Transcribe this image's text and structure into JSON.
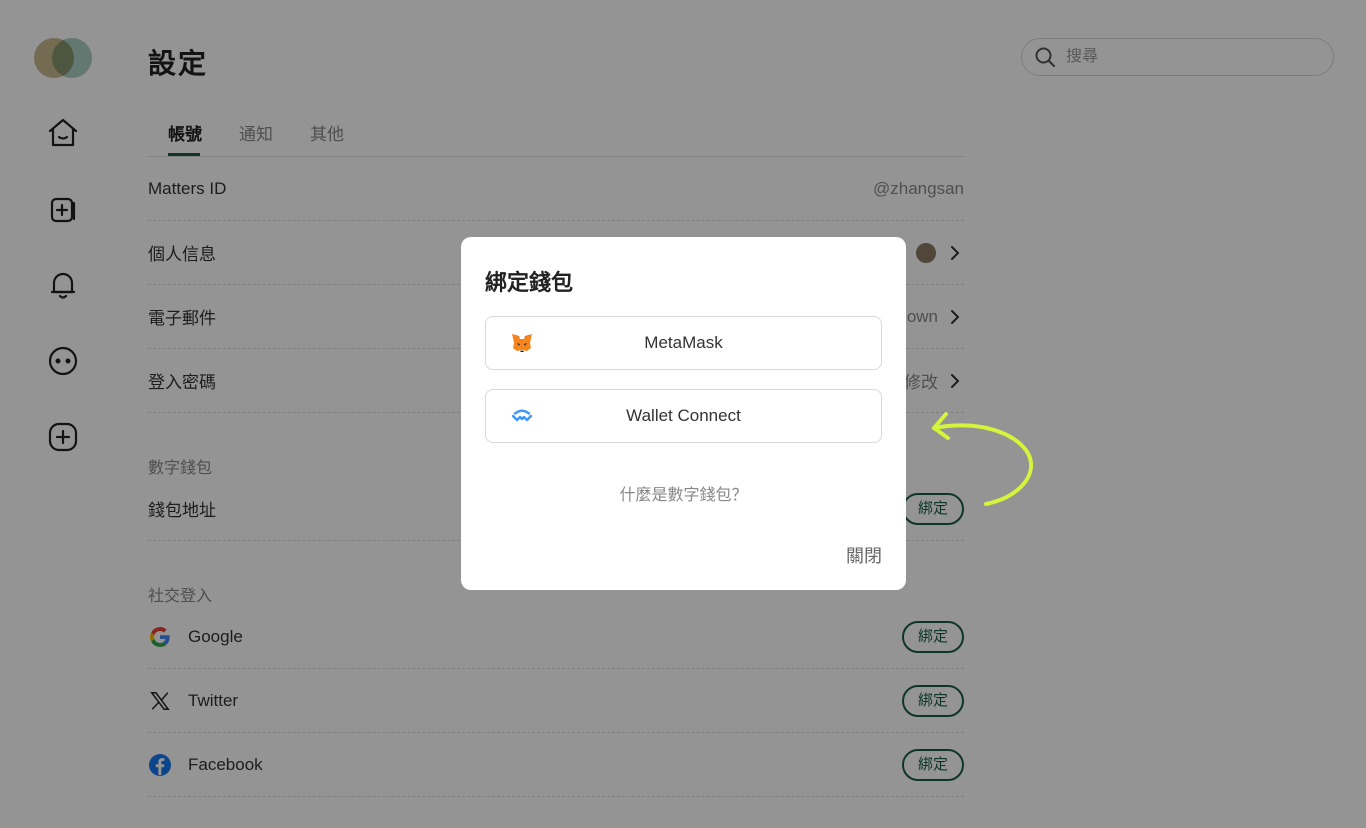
{
  "page": {
    "title": "設定"
  },
  "search": {
    "placeholder": "搜尋"
  },
  "tabs": [
    {
      "label": "帳號",
      "active": true
    },
    {
      "label": "通知",
      "active": false
    },
    {
      "label": "其他",
      "active": false
    }
  ],
  "account": {
    "matters_id": {
      "label": "Matters ID",
      "value": "@zhangsan"
    },
    "profile": {
      "label": "個人信息"
    },
    "email": {
      "label": "電子郵件",
      "value": "own"
    },
    "password": {
      "label": "登入密碼",
      "value": "修改"
    }
  },
  "wallet_section": {
    "title": "數字錢包",
    "address_label": "錢包地址",
    "bind_label": "綁定"
  },
  "social_section": {
    "title": "社交登入",
    "items": [
      {
        "label": "Google",
        "icon": "google-icon",
        "bind_label": "綁定"
      },
      {
        "label": "Twitter",
        "icon": "x-icon",
        "bind_label": "綁定"
      },
      {
        "label": "Facebook",
        "icon": "facebook-icon",
        "bind_label": "綁定"
      }
    ]
  },
  "dialog": {
    "title": "綁定錢包",
    "options": [
      {
        "label": "MetaMask",
        "icon": "metamask-fox-icon"
      },
      {
        "label": "Wallet Connect",
        "icon": "walletconnect-icon"
      }
    ],
    "help_link": "什麼是數字錢包？",
    "close_label": "關閉"
  },
  "colors": {
    "accent": "#1b5c4a",
    "annotation_arrow": "#d4f53c",
    "overlay": "rgba(0,0,0,0.42)"
  }
}
